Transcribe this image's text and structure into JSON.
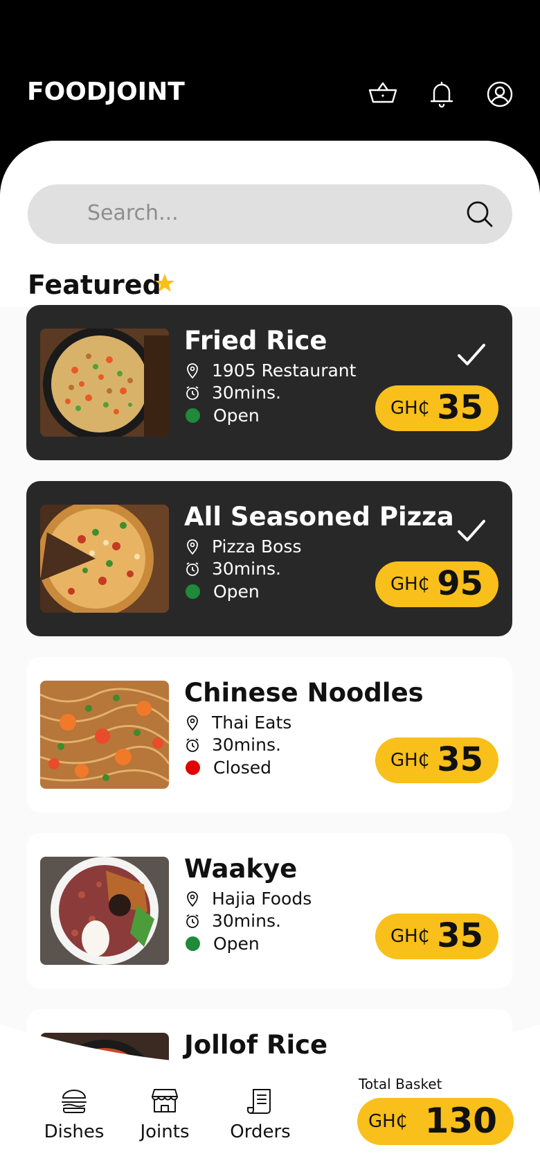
{
  "app": {
    "brand": "FOODJOINT"
  },
  "header": {
    "icons": [
      "basket-icon",
      "bell-icon",
      "user-icon"
    ]
  },
  "search": {
    "placeholder": "Search..."
  },
  "featured": {
    "title": "Featured",
    "icon": "star-icon",
    "star_color": "#f9bf1a"
  },
  "dishes": [
    {
      "name": "Fried Rice",
      "restaurant": "1905 Restaurant",
      "time": "30mins.",
      "status": "Open",
      "status_color": "#1f8a3a",
      "currency": "GH₵",
      "price": "35",
      "selected": true
    },
    {
      "name": "All Seasoned Pizza",
      "restaurant": "Pizza Boss",
      "time": "30mins.",
      "status": "Open",
      "status_color": "#1f8a3a",
      "currency": "GH₵",
      "price": "95",
      "selected": true
    },
    {
      "name": "Chinese Noodles",
      "restaurant": "Thai Eats",
      "time": "30mins.",
      "status": "Closed",
      "status_color": "#e00000",
      "currency": "GH₵",
      "price": "35",
      "selected": false
    },
    {
      "name": "Waakye",
      "restaurant": "Hajia Foods",
      "time": "30mins.",
      "status": "Open",
      "status_color": "#1f8a3a",
      "currency": "GH₵",
      "price": "35",
      "selected": false
    },
    {
      "name": "Jollof Rice"
    }
  ],
  "nav": {
    "items": [
      {
        "label": "Dishes",
        "icon": "burger-icon"
      },
      {
        "label": "Joints",
        "icon": "store-icon"
      },
      {
        "label": "Orders",
        "icon": "receipt-icon"
      }
    ],
    "total_label": "Total Basket",
    "total_currency": "GH₵",
    "total_value": "130"
  },
  "colors": {
    "accent": "#f9bf1a",
    "dark_card": "#282828",
    "header": "#000000"
  }
}
